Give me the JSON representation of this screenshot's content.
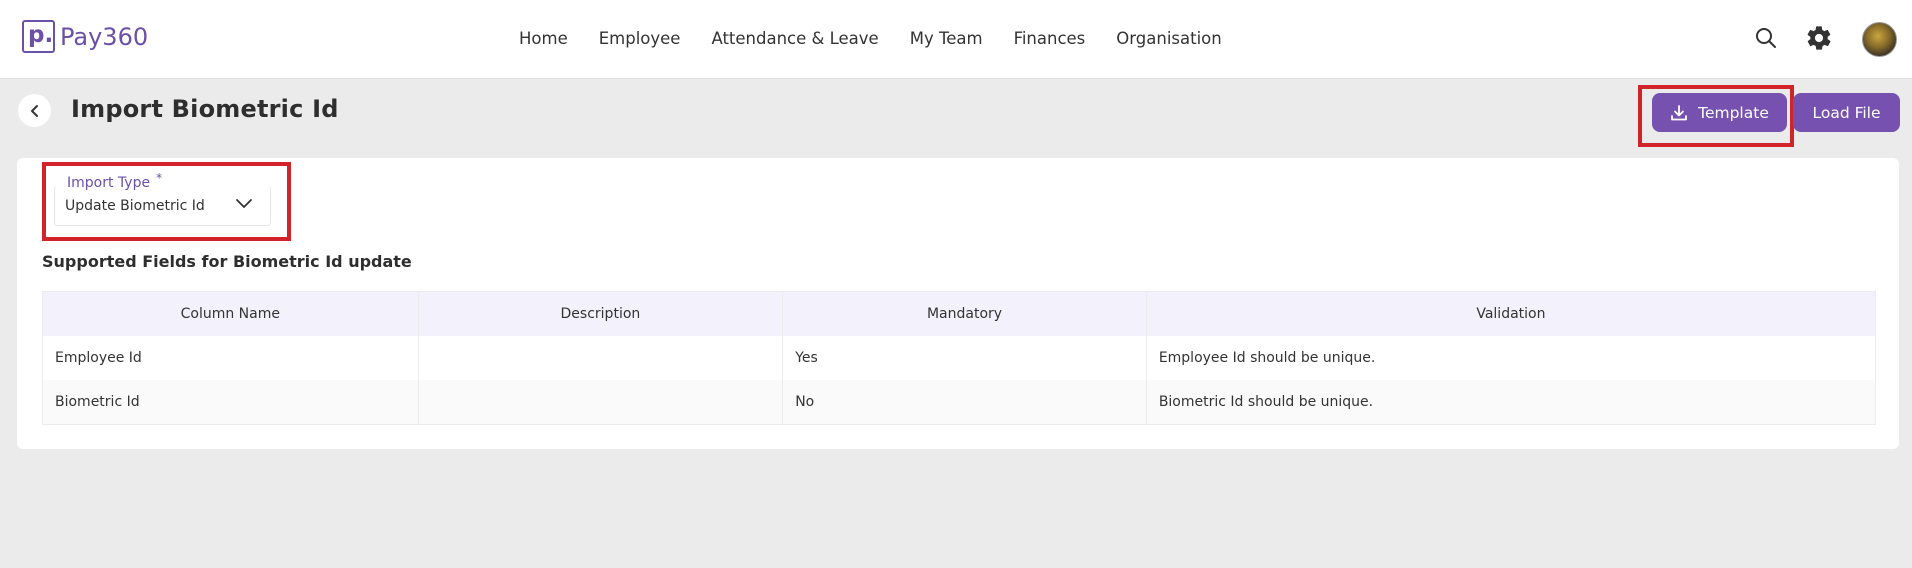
{
  "app": {
    "logo_mark": "p.",
    "name": "Pay360"
  },
  "nav": {
    "items": [
      "Home",
      "Employee",
      "Attendance & Leave",
      "My Team",
      "Finances",
      "Organisation"
    ]
  },
  "page": {
    "title": "Import Biometric Id"
  },
  "actions": {
    "template_label": "Template",
    "load_file_label": "Load File"
  },
  "import_type": {
    "label": "Import Type",
    "required_mark": "*",
    "value": "Update Biometric Id"
  },
  "section": {
    "title": "Supported Fields for Biometric Id update"
  },
  "table": {
    "columns": [
      "Column Name",
      "Description",
      "Mandatory",
      "Validation"
    ],
    "rows": [
      [
        "Employee Id",
        "",
        "Yes",
        "Employee Id should be unique."
      ],
      [
        "Biometric Id",
        "",
        "No",
        "Biometric Id should be unique."
      ]
    ]
  },
  "colors": {
    "brand": "#6b4fa8",
    "button": "#7651b0",
    "highlight": "#d2232a",
    "header_bg": "#f3f1fb"
  },
  "icons": [
    "search-icon",
    "gear-icon",
    "back-arrow-icon",
    "download-icon",
    "chevron-down-icon"
  ]
}
